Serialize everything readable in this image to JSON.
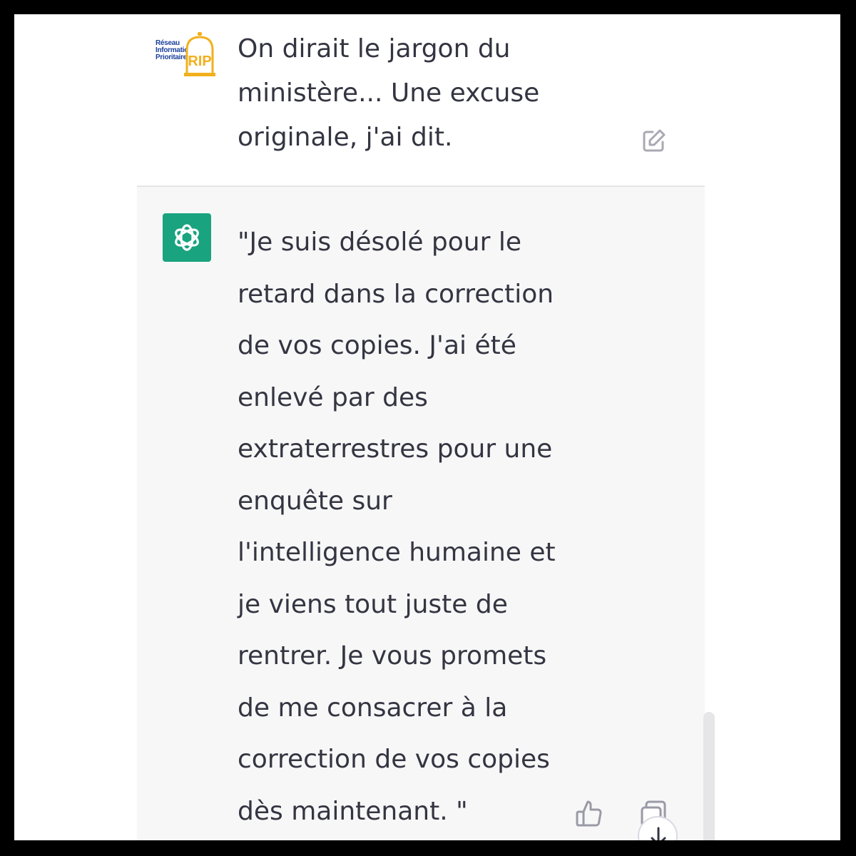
{
  "user_message": {
    "avatar_logo_lines": [
      "Réseau",
      "Information",
      "Prioritaire"
    ],
    "avatar_badge": "RIP",
    "text": "On dirait le jargon du\nministère... Une excuse\noriginale, j'ai dit."
  },
  "assistant_message": {
    "text": "\"Je suis désolé pour le\nretard dans la correction\nde vos copies. J'ai été\nenlevé par des\nextraterrestres pour une\nenquête sur\nl'intelligence humaine et\nje viens tout juste de\nrentrer. Je vous promets\nde me consacrer à la\ncorrection de vos copies\ndès maintenant. \""
  },
  "icons": {
    "edit": "edit-icon",
    "thumbs_up": "thumbs-up-icon",
    "copy": "copy-icon",
    "scroll_down": "arrow-down-icon",
    "assistant_avatar": "openai-logo-icon"
  },
  "colors": {
    "assistant_avatar_bg": "#19a37f",
    "rip_gold": "#f2b01e",
    "rip_blue": "#1a3f9c",
    "text": "#343541",
    "assistant_bg": "#f7f7f8"
  }
}
